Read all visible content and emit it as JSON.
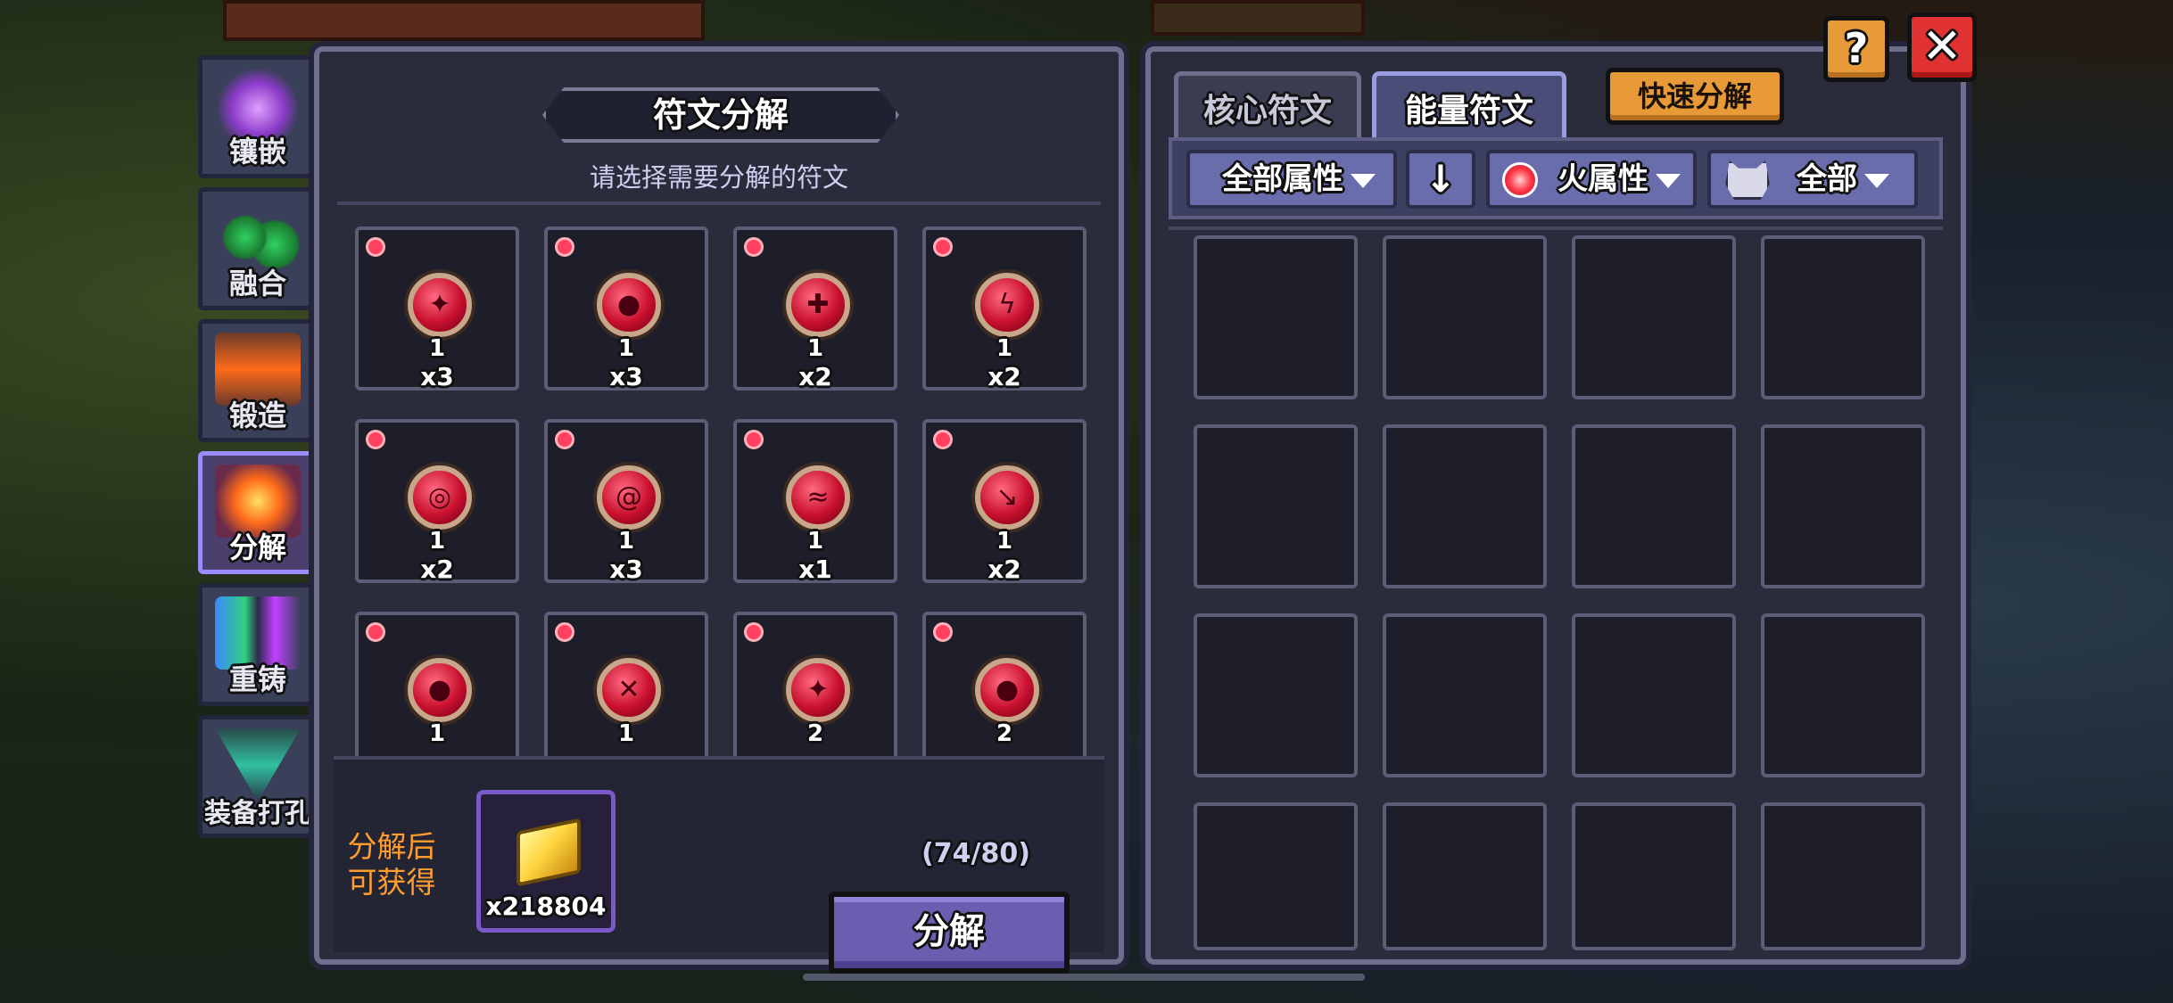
{
  "side_menu": [
    {
      "label": "镶嵌",
      "icon": "inlay-icon",
      "active": false
    },
    {
      "label": "融合",
      "icon": "fusion-icon",
      "active": false
    },
    {
      "label": "锻造",
      "icon": "forge-icon",
      "active": false
    },
    {
      "label": "分解",
      "icon": "decompose-icon",
      "active": true
    },
    {
      "label": "重铸",
      "icon": "recast-icon",
      "active": false
    },
    {
      "label": "装备打孔",
      "icon": "socket-icon",
      "active": false
    }
  ],
  "left_panel": {
    "title": "符文分解",
    "subtitle": "请选择需要分解的符文",
    "runes": [
      {
        "level": "1",
        "count": "x3",
        "glyph": "✦"
      },
      {
        "level": "1",
        "count": "x3",
        "glyph": "●"
      },
      {
        "level": "1",
        "count": "x2",
        "glyph": "✚"
      },
      {
        "level": "1",
        "count": "x2",
        "glyph": "ϟ"
      },
      {
        "level": "1",
        "count": "x2",
        "glyph": "◎"
      },
      {
        "level": "1",
        "count": "x3",
        "glyph": "@"
      },
      {
        "level": "1",
        "count": "x1",
        "glyph": "≈"
      },
      {
        "level": "1",
        "count": "x2",
        "glyph": "↘"
      },
      {
        "level": "1",
        "count": "",
        "glyph": "●"
      },
      {
        "level": "1",
        "count": "",
        "glyph": "✕"
      },
      {
        "level": "2",
        "count": "",
        "glyph": "✦"
      },
      {
        "level": "2",
        "count": "",
        "glyph": "●"
      }
    ],
    "reward_label": "分解后可获得",
    "reward_count": "x218804",
    "capacity": "(74/80)",
    "decompose_button": "分解"
  },
  "right_panel": {
    "tabs": [
      "核心符文",
      "能量符文"
    ],
    "active_tab": "能量符文",
    "quick_button": "快速分解",
    "filters": {
      "attribute": "全部属性",
      "sort_arrow": "↓",
      "element": "火属性",
      "type": "全部"
    },
    "slot_count": 16
  },
  "top_buttons": {
    "help": "?",
    "close": "✕"
  },
  "colors": {
    "accent_purple": "#6a5eb0",
    "orange": "#e89a38",
    "close_red": "#e03232",
    "fire_red": "#c8102e"
  }
}
